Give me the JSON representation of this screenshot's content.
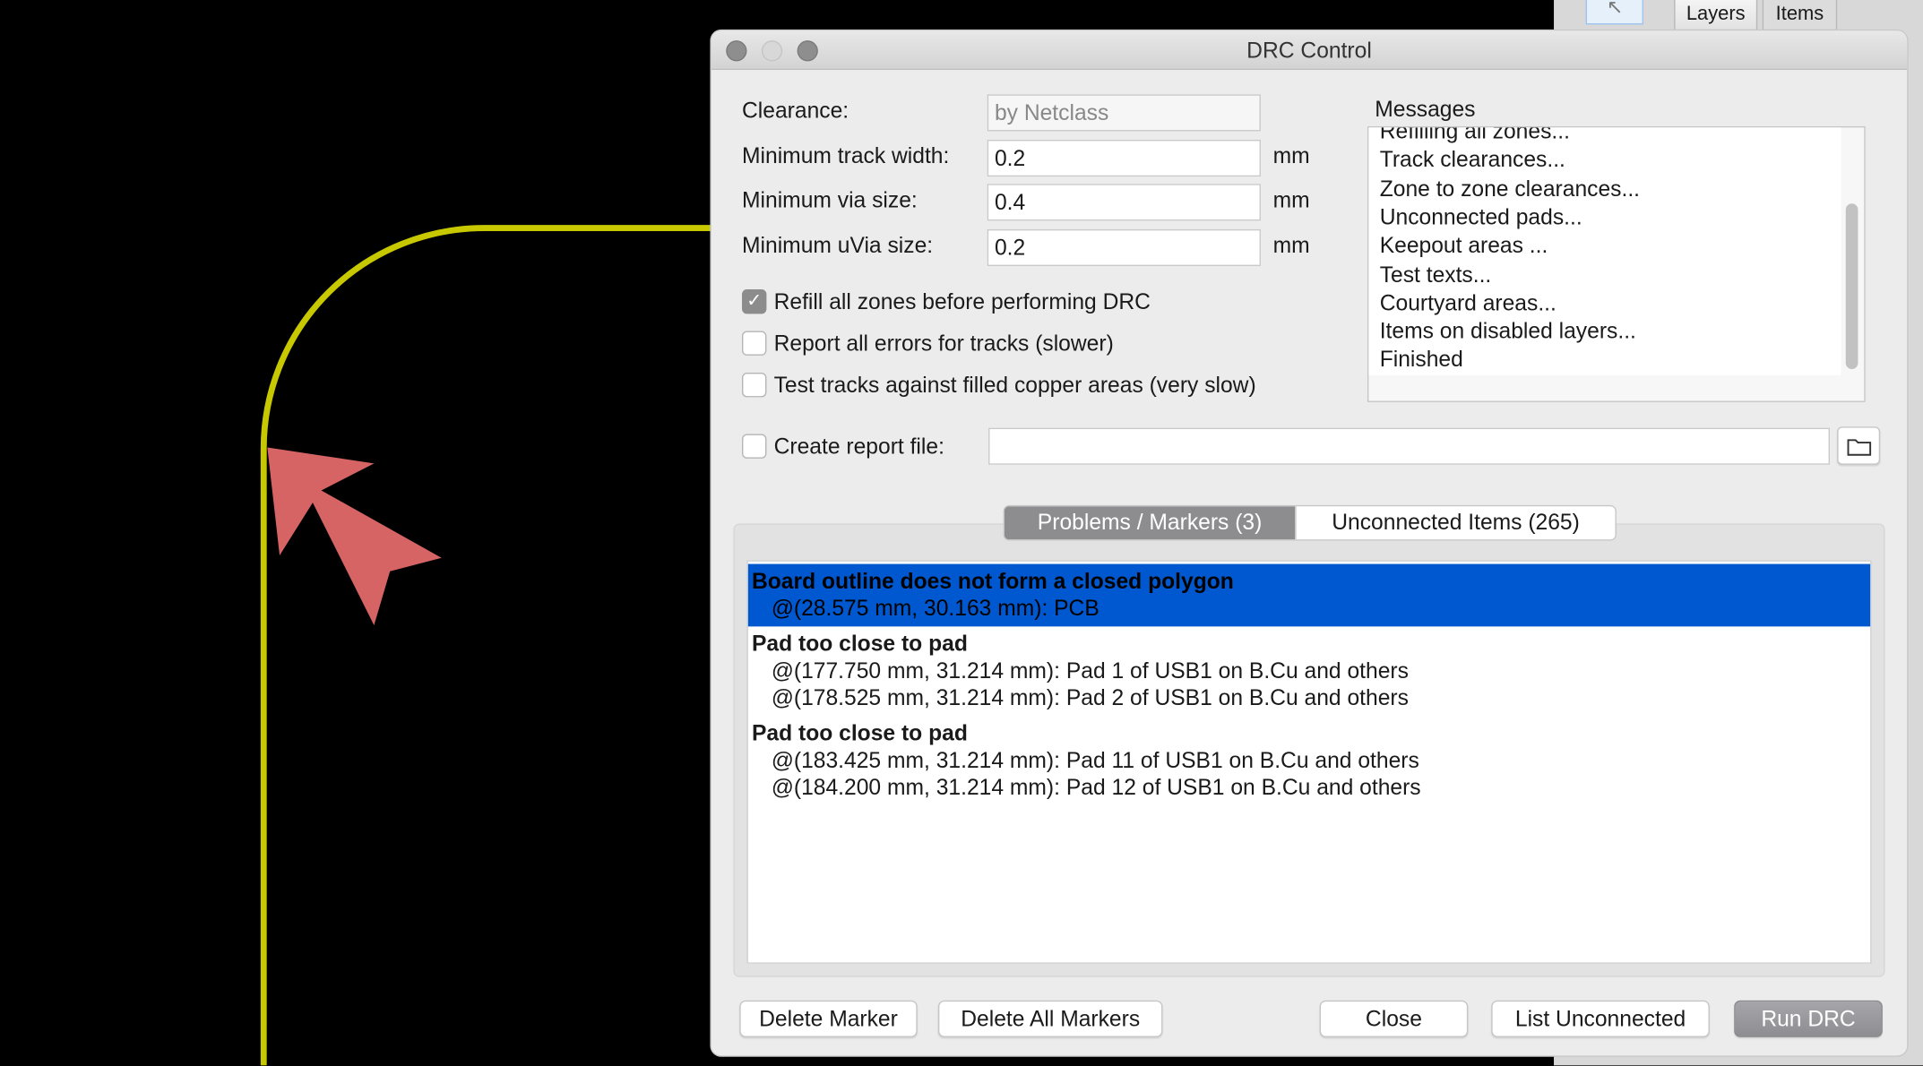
{
  "toolbar": {
    "tabs": [
      "Layers",
      "Items"
    ]
  },
  "dialog": {
    "title": "DRC Control",
    "fields": [
      {
        "label": "Clearance:",
        "value": "by Netclass",
        "unit": "",
        "disabled": true
      },
      {
        "label": "Minimum track width:",
        "value": "0.2",
        "unit": "mm"
      },
      {
        "label": "Minimum via size:",
        "value": "0.4",
        "unit": "mm"
      },
      {
        "label": "Minimum uVia size:",
        "value": "0.2",
        "unit": "mm"
      }
    ],
    "options": [
      {
        "label": "Refill all zones before performing DRC",
        "checked": true
      },
      {
        "label": "Report all errors for tracks (slower)",
        "checked": false
      },
      {
        "label": "Test tracks against filled copper areas (very slow)",
        "checked": false
      }
    ],
    "messages_label": "Messages",
    "messages": [
      "Refilling all zones...",
      "Track clearances...",
      "Zone to zone clearances...",
      "Unconnected pads...",
      "Keepout areas ...",
      "Test texts...",
      "Courtyard areas...",
      "Items on disabled layers...",
      "Finished"
    ],
    "report": {
      "label": "Create report file:",
      "checked": false,
      "value": ""
    },
    "tabs": [
      {
        "label": "Problems / Markers (3)",
        "selected": true
      },
      {
        "label": "Unconnected Items (265)",
        "selected": false
      }
    ],
    "markers": [
      {
        "title": "Board outline does not form a closed polygon",
        "details": [
          "@(28.575 mm, 30.163 mm): PCB"
        ],
        "selected": true
      },
      {
        "title": "Pad too close to pad",
        "details": [
          "@(177.750 mm, 31.214 mm): Pad 1 of USB1 on B.Cu and others",
          "@(178.525 mm, 31.214 mm): Pad 2 of USB1 on B.Cu and others"
        ]
      },
      {
        "title": "Pad too close to pad",
        "details": [
          "@(183.425 mm, 31.214 mm): Pad 11 of USB1 on B.Cu and others",
          "@(184.200 mm, 31.214 mm): Pad 12 of USB1 on B.Cu and others"
        ]
      }
    ],
    "buttons": {
      "delete_marker": "Delete Marker",
      "delete_all": "Delete All Markers",
      "close": "Close",
      "list_unconnected": "List Unconnected",
      "run_drc": "Run DRC"
    }
  },
  "colors": {
    "track": "#c8c800",
    "cursor_arrow": "#d66464",
    "selection": "#0058d0"
  }
}
